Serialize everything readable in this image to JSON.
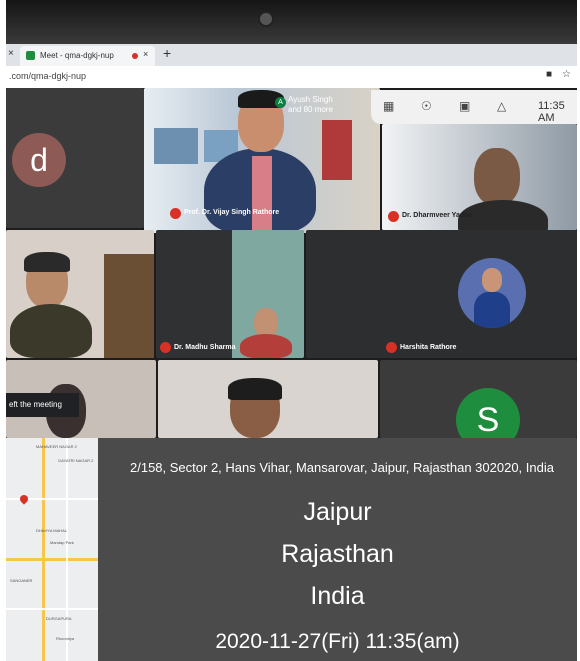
{
  "browser": {
    "tab_title": "Meet - qma-dgkj-nup",
    "url": ".com/qma-dgkj-nup",
    "tab_close": "×",
    "new_tab": "+"
  },
  "meet": {
    "time": "11:35 AM",
    "participants_line1": "Ayush Singh",
    "participants_line2": "and 80 more",
    "participants_badge": "A",
    "left_meeting_note": "eft the meeting",
    "tiles": [
      {
        "name": "",
        "initial": "d",
        "avatar_color": "#8d5a55"
      },
      {
        "name": "Prof. Dr. Vijay Singh Rathore"
      },
      {
        "name": "Dr. Dharmveer Yadav"
      },
      {
        "name": ""
      },
      {
        "name": "Dr. Madhu Sharma"
      },
      {
        "name": "Harshita Rathore"
      },
      {
        "name": ""
      },
      {
        "name": ""
      },
      {
        "name": "",
        "initial": "S",
        "avatar_color": "#1e8e3e"
      }
    ],
    "accent_red": "#d93025",
    "accent_green": "#1e8e3e"
  },
  "stamp": {
    "address": "2/158, Sector 2, Hans Vihar, Mansarovar, Jaipur, Rajasthan 302020, India",
    "city": "Jaipur",
    "state": "Rajasthan",
    "country": "India",
    "datetime": "2020-11-27(Fri)   11:35(am)"
  },
  "map": {
    "labels": [
      "MAHAVEER NAGAR 2",
      "GAYATRI NAGAR 2",
      "DHAHYA MAHAL",
      "Mandap Park",
      "SANGANER",
      "DURGAPURA",
      "Rhoomiya"
    ]
  }
}
